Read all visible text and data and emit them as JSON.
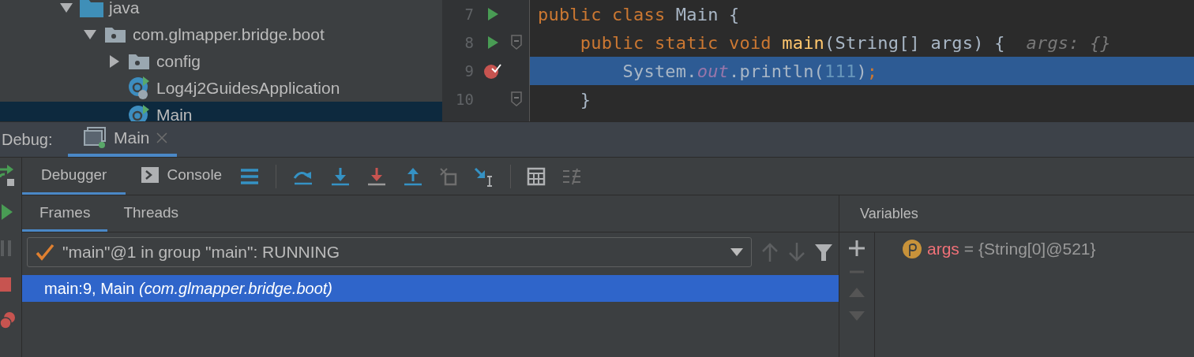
{
  "project_tree": {
    "items": [
      {
        "label": "java",
        "kind": "source-folder",
        "expanded": true,
        "selected": false,
        "children": [
          {
            "label": "com.glmapper.bridge.boot",
            "kind": "package",
            "expanded": true,
            "selected": false,
            "children": [
              {
                "label": "config",
                "kind": "package",
                "expanded": false,
                "selected": false
              },
              {
                "label": "Log4j2GuidesApplication",
                "kind": "spring-class",
                "selected": false
              },
              {
                "label": "Main",
                "kind": "class",
                "selected": true
              }
            ]
          }
        ]
      }
    ]
  },
  "editor": {
    "lines": [
      {
        "number": "7",
        "run_marker": true,
        "breakpoint": false,
        "fold": false,
        "current": false,
        "tokens": [
          {
            "text": "public class ",
            "kind": "keyword"
          },
          {
            "text": "Main {",
            "kind": "plain"
          }
        ]
      },
      {
        "number": "8",
        "run_marker": true,
        "breakpoint": false,
        "fold": true,
        "current": false,
        "tokens": [
          {
            "text": "    public static void ",
            "kind": "keyword"
          },
          {
            "text": "main",
            "kind": "method"
          },
          {
            "text": "(String[] args) {",
            "kind": "plain"
          },
          {
            "text": "  args: {}",
            "kind": "hint"
          }
        ]
      },
      {
        "number": "9",
        "run_marker": false,
        "breakpoint": true,
        "fold": false,
        "current": true,
        "tokens": [
          {
            "text": "        System.",
            "kind": "plain"
          },
          {
            "text": "out",
            "kind": "field"
          },
          {
            "text": ".println(",
            "kind": "plain"
          },
          {
            "text": "111",
            "kind": "number"
          },
          {
            "text": ")",
            "kind": "plain"
          },
          {
            "text": ";",
            "kind": "keyword"
          }
        ]
      },
      {
        "number": "10",
        "run_marker": false,
        "breakpoint": false,
        "fold": true,
        "current": false,
        "tokens": [
          {
            "text": "    }",
            "kind": "plain"
          }
        ]
      }
    ]
  },
  "debug": {
    "label": "Debug:",
    "session_tab": {
      "label": "Main",
      "selected": true
    },
    "side_tools": [
      {
        "kind": "rerun",
        "disabled": false
      },
      {
        "kind": "resume",
        "disabled": false
      },
      {
        "kind": "pause",
        "disabled": true
      },
      {
        "kind": "stop",
        "disabled": false
      },
      {
        "kind": "mute",
        "disabled": false
      }
    ],
    "tabs": [
      {
        "label": "Debugger",
        "kind": "debugger",
        "selected": true
      },
      {
        "label": "Console",
        "kind": "console",
        "selected": false
      }
    ],
    "toolbar": [
      {
        "kind": "layout",
        "disabled": false
      },
      {
        "kind": "step-over",
        "disabled": false
      },
      {
        "kind": "step-into",
        "disabled": false
      },
      {
        "kind": "force-step-into",
        "disabled": false
      },
      {
        "kind": "step-out",
        "disabled": false
      },
      {
        "kind": "drop-frame",
        "disabled": true
      },
      {
        "kind": "run-to-cursor",
        "disabled": false
      },
      {
        "kind": "evaluate",
        "disabled": false
      },
      {
        "kind": "trace",
        "disabled": true
      }
    ],
    "frame_tabs": [
      {
        "label": "Frames",
        "selected": true
      },
      {
        "label": "Threads",
        "selected": false
      }
    ],
    "thread": {
      "value": "\"main\"@1 in group \"main\": RUNNING"
    },
    "frames": [
      {
        "method": "main:9, Main",
        "package": "(com.glmapper.bridge.boot)",
        "selected": true
      }
    ],
    "variables": {
      "title": "Variables",
      "items": [
        {
          "name": "args",
          "value": "= {String[0]@521}"
        }
      ]
    }
  }
}
